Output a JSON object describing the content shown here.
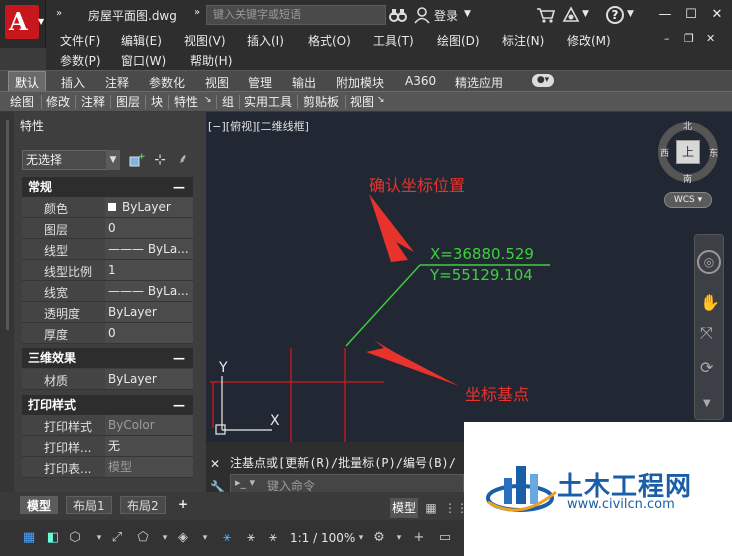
{
  "titlebar": {
    "filename": "房屋平面图.dwg",
    "search_placeholder": "键入关键字或短语",
    "login": "登录",
    "overflow": "»"
  },
  "menubar": {
    "row1": [
      "文件(F)",
      "编辑(E)",
      "视图(V)",
      "插入(I)",
      "格式(O)",
      "工具(T)",
      "绘图(D)",
      "标注(N)",
      "修改(M)"
    ],
    "row2": [
      "参数(P)",
      "窗口(W)",
      "帮助(H)"
    ]
  },
  "ribbon": {
    "tabs": [
      "默认",
      "插入",
      "注释",
      "参数化",
      "视图",
      "管理",
      "输出",
      "附加模块",
      "A360",
      "精选应用"
    ],
    "active": "默认",
    "panels": [
      "绘图",
      "修改",
      "注释",
      "图层",
      "块",
      "特性",
      "组",
      "实用工具",
      "剪贴板",
      "视图"
    ]
  },
  "properties": {
    "title": "特性",
    "selection": "无选择",
    "sections": [
      {
        "name": "常规",
        "rows": [
          [
            "颜色",
            "ByLayer"
          ],
          [
            "图层",
            "0"
          ],
          [
            "线型",
            "——— ByLa..."
          ],
          [
            "线型比例",
            "1"
          ],
          [
            "线宽",
            "——— ByLa..."
          ],
          [
            "透明度",
            "ByLayer"
          ],
          [
            "厚度",
            "0"
          ]
        ]
      },
      {
        "name": "三维效果",
        "rows": [
          [
            "材质",
            "ByLayer"
          ]
        ]
      },
      {
        "name": "打印样式",
        "rows": [
          [
            "打印样式",
            "ByColor"
          ],
          [
            "打印样...",
            "无"
          ],
          [
            "打印表...",
            "模型"
          ]
        ]
      }
    ]
  },
  "canvas": {
    "viewport_label": "[−][俯视][二维线框]",
    "coord_x": "X=36880.529",
    "coord_y": "Y=55129.104",
    "annotation_top": "确认坐标位置",
    "annotation_base": "坐标基点",
    "viewcube": {
      "north": "北",
      "south": "南",
      "east": "东",
      "west": "西",
      "top": "上",
      "wcs": "WCS"
    },
    "ucs_x": "X",
    "ucs_y": "Y"
  },
  "command": {
    "history": "注基点或[更新(R)/批量标(P)/编号(B)/",
    "placeholder": "键入命令"
  },
  "layouts": {
    "tabs": [
      "模型",
      "布局1",
      "布局2"
    ],
    "active": "模型",
    "add": "+"
  },
  "statusbar": {
    "model": "模型",
    "scale": "1:1 / 100%"
  },
  "watermark": {
    "title": "土木工程网",
    "url": "www.civilcn.com"
  },
  "colors": {
    "accent_red": "#e8322c",
    "coord_green": "#3fcf3f",
    "crosshair_red": "#d01a1a",
    "canvas_bg": "#222833",
    "logo_red": "#c8161d",
    "watermark_blue": "#1a5ea8"
  }
}
